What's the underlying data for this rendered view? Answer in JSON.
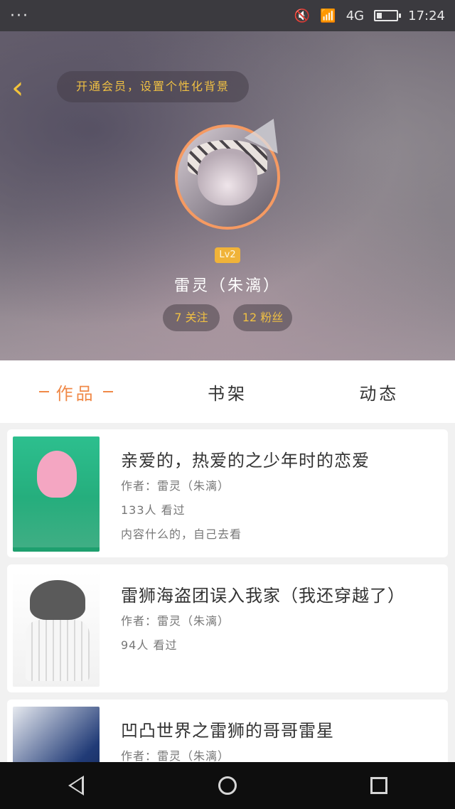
{
  "status_bar": {
    "left_indicator": "···",
    "network": "4G",
    "time": "17:24"
  },
  "header": {
    "back_icon": "‹",
    "vip_text": "开通会员，设置个性化背景",
    "level": "Lv2",
    "username": "雷灵（朱漓）",
    "following": "7 关注",
    "fans": "12 粉丝"
  },
  "tabs": [
    {
      "label": "作品",
      "active": true
    },
    {
      "label": "书架",
      "active": false
    },
    {
      "label": "动态",
      "active": false
    }
  ],
  "works": [
    {
      "title": "亲爱的，热爱的之少年时的恋爱",
      "author": "作者：雷灵（朱漓）",
      "views": "133人 看过",
      "desc": "内容什么的，自己去看"
    },
    {
      "title": "雷狮海盗团误入我家（我还穿越了）",
      "author": "作者：雷灵（朱漓）",
      "views": "94人 看过"
    },
    {
      "title": "凹凸世界之雷狮的哥哥雷星",
      "author": "作者：雷灵（朱漓）"
    }
  ],
  "colors": {
    "accent": "#f08948",
    "gold": "#f0c043"
  }
}
